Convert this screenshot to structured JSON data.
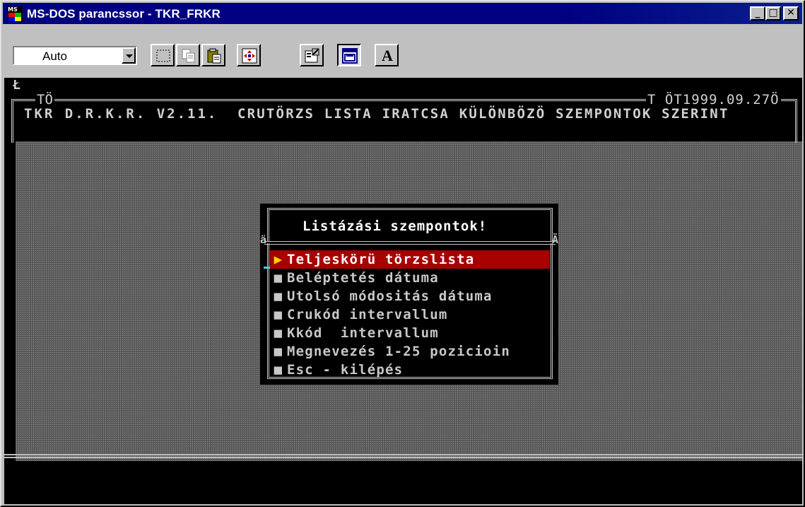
{
  "window": {
    "title": "MS-DOS parancssor - TKR_FRKR",
    "icon": "ms-dos-icon",
    "controls": [
      "minimize-icon",
      "maximize-icon",
      "close-icon"
    ],
    "control_glyphs": {
      "minimize": "_",
      "maximize": "□",
      "close": "✕"
    },
    "icon_text": "MS"
  },
  "toolbar": {
    "font_size_value": "Auto",
    "buttons": [
      "mark-icon",
      "copy-icon",
      "paste-icon",
      "fullscreen-icon",
      "properties-icon",
      "background-icon",
      "font-icon"
    ],
    "font_button_label": "A"
  },
  "console": {
    "prompt_glyph": "Ł",
    "header_left_tab": "TÖ",
    "header_right_tab": "T ÖT1999.09.27Ö",
    "header_app": "TKR D.R.K.R. V2.11.",
    "header_subtitle": "CRUTÖRZS LISTA IRATCSA KÜLÖNBÖZÖ SZEMPONTOK SZERINT",
    "menu": {
      "title": "Listázási szempontok!",
      "sep_left": "ä",
      "sep_right": "Ä",
      "selected_bullet": "▶",
      "bullet": "■",
      "items": [
        "Teljeskörü törzslista",
        "Beléptetés dátuma",
        "Utolsó módositás dátuma",
        "Crukód intervallum",
        "Kkód  intervallum",
        "Megnevezés 1-25 pozicioin",
        "Esc - kilépés"
      ]
    }
  },
  "colors": {
    "titlebar": "#000080",
    "selection": "#a80000",
    "text": "#c8c8c8"
  }
}
